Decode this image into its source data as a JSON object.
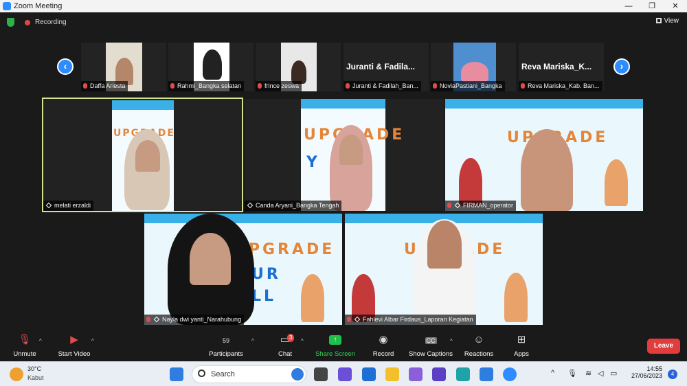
{
  "window": {
    "title": "Zoom Meeting",
    "controls": [
      "—",
      "❐",
      "✕"
    ]
  },
  "topbar": {
    "recording_label": "Recording",
    "view_label": "View"
  },
  "thumbnails": [
    {
      "name": "Daffa Ariesta",
      "big_label": ""
    },
    {
      "name": "Rahmi_Bangka selatan",
      "big_label": ""
    },
    {
      "name": "frince zeswa",
      "big_label": ""
    },
    {
      "name": "Juranti & Fadilah_Ban...",
      "big_label": "Juranti & Fadila..."
    },
    {
      "name": "NoviaPastiani_Bangka",
      "big_label": ""
    },
    {
      "name": "Reva Mariska_Kab. Ban...",
      "big_label": "Reva Mariska_K..."
    }
  ],
  "tiles": [
    {
      "name": "melati erzaldi"
    },
    {
      "name": "Canda Aryani_Bangka Tengah"
    },
    {
      "name": "FIRMAN_operator"
    },
    {
      "name": "Nayla dwi yanti_Narahubung"
    },
    {
      "name": "Fahlevi Albar Firdaus_Laporan Kegiatan"
    }
  ],
  "background_text": {
    "upgrade": "UPGRADE",
    "word_y": "Y",
    "word_ur": "UR",
    "word_ll": "LL"
  },
  "toolbar": {
    "unmute": "Unmute",
    "start_video": "Start Video",
    "participants": "Participants",
    "participants_count": "59",
    "chat": "Chat",
    "chat_badge": "3",
    "share_screen": "Share Screen",
    "record": "Record",
    "show_captions": "Show Captions",
    "captions_icon": "CC",
    "reactions": "Reactions",
    "apps": "Apps",
    "leave": "Leave"
  },
  "taskbar": {
    "temperature": "30°C",
    "condition": "Kabut",
    "search_placeholder": "Search",
    "time": "14:55",
    "date": "27/06/2023",
    "notification_count": "4"
  },
  "colors": {
    "accent": "#2d8cff",
    "leave": "#e23c3c",
    "share": "#1fbf48",
    "active_border": "#d7e38a"
  }
}
